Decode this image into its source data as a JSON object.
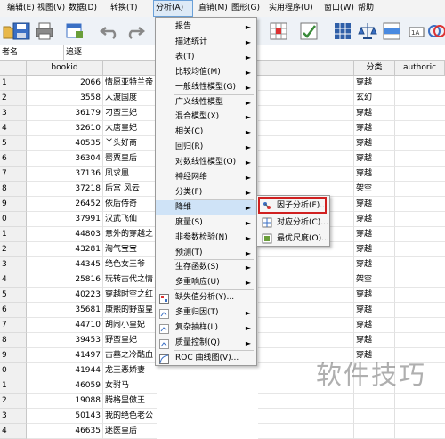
{
  "menubar": {
    "items": [
      {
        "label": "编辑(E)"
      },
      {
        "label": "视图(V)"
      },
      {
        "label": "数据(D)"
      },
      {
        "label": "转换(T)"
      },
      {
        "label": "分析(A)"
      },
      {
        "label": "直销(M)"
      },
      {
        "label": "图形(G)"
      },
      {
        "label": "实用程序(U)"
      },
      {
        "label": "窗口(W)"
      },
      {
        "label": "帮助"
      }
    ]
  },
  "varbar": {
    "name": "者名",
    "value": "追逐"
  },
  "grid": {
    "headers": {
      "bookid": "bookid",
      "category": "分类",
      "author": "authoric"
    },
    "rows": [
      {
        "rownum": "1",
        "bookid": "2066",
        "name": "情愿亚特兰帝",
        "category": "穿越"
      },
      {
        "rownum": "2",
        "bookid": "3558",
        "name": "人渡国度",
        "category": "玄幻"
      },
      {
        "rownum": "3",
        "bookid": "36179",
        "name": "刁蛮王妃",
        "category": "穿越"
      },
      {
        "rownum": "4",
        "bookid": "32610",
        "name": "大唐皇妃",
        "category": "穿越"
      },
      {
        "rownum": "5",
        "bookid": "40535",
        "name": "丫头好商",
        "category": "穿越"
      },
      {
        "rownum": "6",
        "bookid": "36304",
        "name": "罂粟皇后",
        "category": "穿越"
      },
      {
        "rownum": "7",
        "bookid": "37136",
        "name": "凤求凰",
        "category": "穿越"
      },
      {
        "rownum": "8",
        "bookid": "37218",
        "name": "后宫 风云",
        "category": "架空"
      },
      {
        "rownum": "9",
        "bookid": "26452",
        "name": "依后侍奇",
        "category": "穿越"
      },
      {
        "rownum": "0",
        "bookid": "37991",
        "name": "汉武飞仙",
        "category": "穿越"
      },
      {
        "rownum": "1",
        "bookid": "44803",
        "name": "意外的穿越之",
        "category": "穿越"
      },
      {
        "rownum": "2",
        "bookid": "43281",
        "name": "淘气宝宝",
        "category": "穿越"
      },
      {
        "rownum": "3",
        "bookid": "44345",
        "name": "绝色女王爷",
        "category": "穿越"
      },
      {
        "rownum": "4",
        "bookid": "25816",
        "name": "玩转古代之情",
        "category": "架空"
      },
      {
        "rownum": "5",
        "bookid": "40223",
        "name": "穿越时空之红",
        "category": "穿越"
      },
      {
        "rownum": "6",
        "bookid": "35681",
        "name": "康熙的野蛮皇",
        "category": "穿越"
      },
      {
        "rownum": "7",
        "bookid": "44710",
        "name": "胡闹小皇妃",
        "category": "穿越"
      },
      {
        "rownum": "8",
        "bookid": "39453",
        "name": "野蛮皇妃",
        "category": "穿越"
      },
      {
        "rownum": "9",
        "bookid": "41497",
        "name": "古墓之冷酷血",
        "category": "穿越"
      },
      {
        "rownum": "0",
        "bookid": "41944",
        "name": "龙王恶娇妻",
        "category": ""
      },
      {
        "rownum": "1",
        "bookid": "46059",
        "name": "女驸马",
        "category": ""
      },
      {
        "rownum": "2",
        "bookid": "19088",
        "name": "腾格里傲王",
        "category": ""
      },
      {
        "rownum": "3",
        "bookid": "50143",
        "name": "我的绝色老公",
        "category": ""
      },
      {
        "rownum": "4",
        "bookid": "46635",
        "name": "迷医皇后",
        "category": ""
      }
    ]
  },
  "analyze_menu": {
    "items": [
      {
        "label": "报告",
        "arrow": "►"
      },
      {
        "label": "描述统计",
        "arrow": "►"
      },
      {
        "label": "表(T)",
        "arrow": "►"
      },
      {
        "label": "比较均值(M)",
        "arrow": "►"
      },
      {
        "label": "一般线性模型(G)",
        "arrow": "►"
      },
      {
        "label": "广义线性模型",
        "arrow": "►"
      },
      {
        "label": "混合模型(X)",
        "arrow": "►"
      },
      {
        "label": "相关(C)",
        "arrow": "►"
      },
      {
        "label": "回归(R)",
        "arrow": "►"
      },
      {
        "label": "对数线性模型(O)",
        "arrow": "►"
      },
      {
        "label": "神经网络",
        "arrow": "►"
      },
      {
        "label": "分类(F)",
        "arrow": "►"
      },
      {
        "label": "降维",
        "arrow": "►"
      },
      {
        "label": "度量(S)",
        "arrow": "►"
      },
      {
        "label": "非参数检验(N)",
        "arrow": "►"
      },
      {
        "label": "预测(T)",
        "arrow": "►"
      },
      {
        "label": "生存函数(S)",
        "arrow": "►"
      },
      {
        "label": "多重响应(U)",
        "arrow": "►"
      },
      {
        "label": "缺失值分析(Y)...",
        "arrow": ""
      },
      {
        "label": "多重归因(T)",
        "arrow": "►"
      },
      {
        "label": "复杂抽样(L)",
        "arrow": "►"
      },
      {
        "label": "质量控制(Q)",
        "arrow": "►"
      },
      {
        "label": "ROC 曲线图(V)...",
        "arrow": ""
      }
    ]
  },
  "reduce_submenu": {
    "items": [
      {
        "label": "因子分析(F)..."
      },
      {
        "label": "对应分析(C)..."
      },
      {
        "label": "最优尺度(O)..."
      }
    ]
  },
  "watermark": "软件技巧",
  "colors": {
    "highlight": "#cfe3f7",
    "red_box": "#d02020"
  }
}
